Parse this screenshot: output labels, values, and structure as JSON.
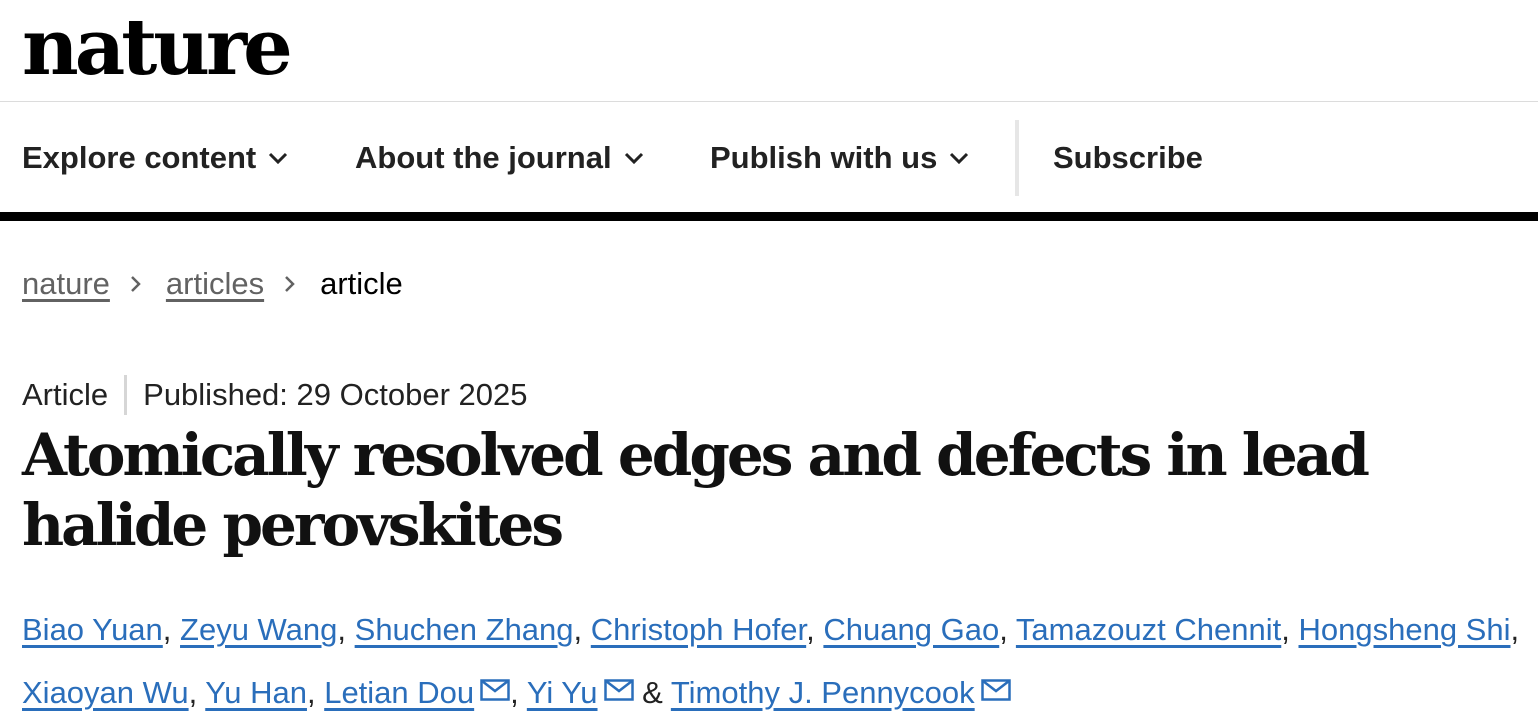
{
  "logo": "nature",
  "nav": {
    "items": [
      {
        "label": "Explore content"
      },
      {
        "label": "About the journal"
      },
      {
        "label": "Publish with us"
      }
    ],
    "subscribe": "Subscribe"
  },
  "breadcrumb": [
    "nature",
    "articles",
    "article"
  ],
  "article": {
    "type": "Article",
    "published": "Published: 29 October 2025",
    "title": "Atomically resolved edges and defects in lead halide perovskites",
    "authors": [
      "Biao Yuan",
      "Zeyu Wang",
      "Shuchen Zhang",
      "Christoph Hofer",
      "Chuang Gao",
      "Tamazouzt Chennit",
      "Hongsheng Shi",
      "Xiaoyan Wu",
      "Yu Han",
      "Letian Dou",
      "Yi Yu",
      "Timothy J. Pennycook"
    ],
    "separator": ", ",
    "last_separator": " & "
  },
  "colors": {
    "link": "#2a6ebb",
    "crumb": "#626262"
  },
  "icons": {
    "nav_dropdown": "chevron-down-icon",
    "breadcrumb": "chevron-right-icon",
    "contact": "mail-icon"
  }
}
